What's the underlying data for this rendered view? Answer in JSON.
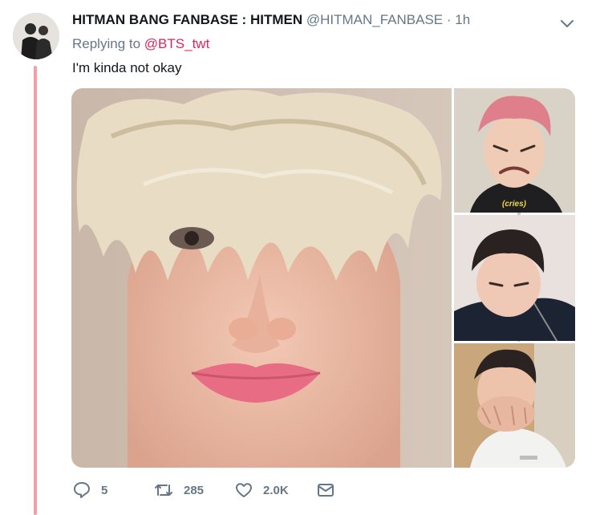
{
  "tweet": {
    "display_name": "HITMAN BANG FANBASE : HITMEN",
    "handle": "@HITMAN_FANBASE",
    "separator": "·",
    "time": "1h",
    "reply_prefix": "Replying to",
    "reply_handle": "@BTS_twt",
    "text": "I'm kinda not okay",
    "media_caption_cries": "(cries)"
  },
  "actions": {
    "reply_count": "5",
    "retweet_count": "285",
    "like_count": "2.0K"
  },
  "icons": {
    "menu": "chevron-down-icon",
    "reply": "speech-bubble-icon",
    "retweet": "retweet-icon",
    "like": "heart-icon",
    "dm": "envelope-icon"
  },
  "colors": {
    "reply_handle": "#e0245e",
    "thread_line": "#f0a0a6",
    "secondary_text": "#657786",
    "caption": "#f2d64b"
  }
}
